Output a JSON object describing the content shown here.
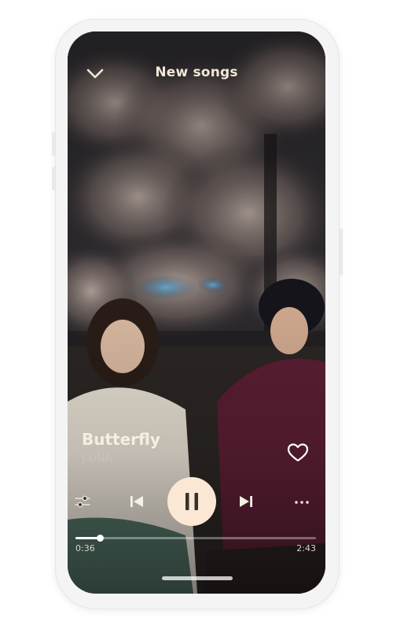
{
  "header": {
    "title": "New songs",
    "back_icon": "chevron-down-icon"
  },
  "track": {
    "title": "Butterfly",
    "artist": "J.UNA",
    "liked": false,
    "progress_fraction": 0.1
  },
  "player": {
    "elapsed": "0:36",
    "duration": "2:43",
    "state": "playing",
    "icons": {
      "equalizer": "equalizer-icon",
      "previous": "skip-previous-icon",
      "play_pause": "pause-icon",
      "next": "skip-next-icon",
      "more": "more-horizontal-icon",
      "like": "heart-icon"
    }
  },
  "colors": {
    "accent": "#fae8d4",
    "title_text": "#f1e7d6"
  }
}
